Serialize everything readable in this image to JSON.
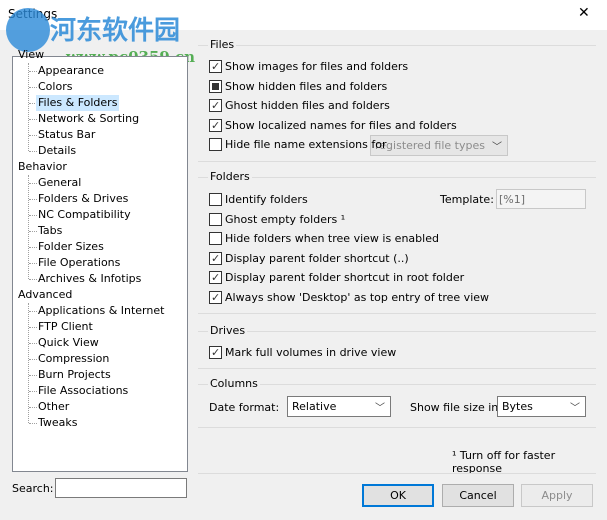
{
  "window": {
    "title": "Settings",
    "close": "✕"
  },
  "watermark": {
    "text": "河东软件园",
    "url": "www.pc0359.cn"
  },
  "tree": {
    "sections": [
      {
        "label": "View",
        "items": [
          "Appearance",
          "Colors",
          "Files & Folders",
          "Network & Sorting",
          "Status Bar",
          "Details"
        ]
      },
      {
        "label": "Behavior",
        "items": [
          "General",
          "Folders & Drives",
          "NC Compatibility",
          "Tabs",
          "Folder Sizes",
          "File Operations",
          "Archives & Infotips"
        ]
      },
      {
        "label": "Advanced",
        "items": [
          "Applications & Internet",
          "FTP Client",
          "Quick View",
          "Compression",
          "Burn Projects",
          "File Associations",
          "Other",
          "Tweaks"
        ]
      }
    ],
    "selected": "Files & Folders"
  },
  "search": {
    "label": "Search:",
    "value": ""
  },
  "files": {
    "title": "Files",
    "options": [
      {
        "label": "Show images for files and folders",
        "state": "checked"
      },
      {
        "label": "Show hidden files and folders",
        "state": "indeterminate"
      },
      {
        "label": "Ghost hidden files and folders",
        "state": "checked"
      },
      {
        "label": "Show localized names for files and folders",
        "state": "checked"
      },
      {
        "label": "Hide file name extensions for",
        "state": "unchecked"
      }
    ],
    "ext_select": "registered file types"
  },
  "folders": {
    "title": "Folders",
    "template_label": "Template:",
    "template_value": "[%1]",
    "options": [
      {
        "label": "Identify folders",
        "state": "unchecked"
      },
      {
        "label": "Ghost empty folders ¹",
        "state": "unchecked"
      },
      {
        "label": "Hide folders when tree view is enabled",
        "state": "unchecked"
      },
      {
        "label": "Display parent folder shortcut (..)",
        "state": "checked"
      },
      {
        "label": "Display parent folder shortcut in root folder",
        "state": "checked"
      },
      {
        "label": "Always show 'Desktop' as top entry of tree view",
        "state": "checked"
      }
    ]
  },
  "drives": {
    "title": "Drives",
    "options": [
      {
        "label": "Mark full volumes in drive view",
        "state": "checked"
      }
    ]
  },
  "columns": {
    "title": "Columns",
    "date_label": "Date format:",
    "date_value": "Relative",
    "size_label": "Show file size in:",
    "size_value": "Bytes"
  },
  "footnote": "¹ Turn off for faster response",
  "buttons": {
    "ok": "OK",
    "cancel": "Cancel",
    "apply": "Apply"
  }
}
